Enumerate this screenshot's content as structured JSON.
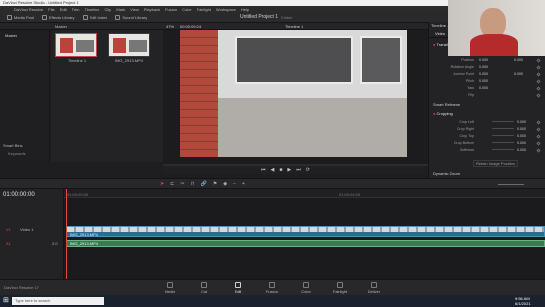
{
  "window": {
    "title": "DaVinci Resolve Studio - Untitled Project 1"
  },
  "menu": [
    "DaVinci Resolve",
    "File",
    "Edit",
    "Trim",
    "Timeline",
    "Clip",
    "Mark",
    "View",
    "Playback",
    "Fusion",
    "Color",
    "Fairlight",
    "Workspace",
    "Help"
  ],
  "toolbar": {
    "media_pool": "Media Pool",
    "effects_library": "Effects Library",
    "edit_index": "Edit Index",
    "sound_library": "Sound Library",
    "project_title": "Untitled Project 1",
    "project_status": "Edited",
    "mixer": "Mixer",
    "metadata": "Metadata",
    "inspector": "Inspector"
  },
  "subbar": {
    "bin_label": "Master",
    "zoom": "47%",
    "source_timecode": "00:00:09:24",
    "timeline_name": "Timeline 1",
    "timeline_name_right": "Timeline - I..."
  },
  "left_panel": {
    "master": "Master",
    "smart_bins": "Smart Bins",
    "keywords": "Keywords"
  },
  "media_pool": {
    "clips": [
      {
        "name": "Timeline 1"
      },
      {
        "name": "IMG_2913.MP4"
      }
    ]
  },
  "inspector": {
    "tabs": [
      "Video",
      "Audio"
    ],
    "section_transform": "Transform",
    "rows": [
      {
        "label": "Zoom",
        "x": "1.000",
        "y": "1.000"
      },
      {
        "label": "Position",
        "x": "0.000",
        "y": "0.000"
      },
      {
        "label": "Rotation Angle",
        "x": "0.000"
      },
      {
        "label": "Anchor Point",
        "x": "0.000",
        "y": "0.000"
      },
      {
        "label": "Pitch",
        "x": "0.000"
      },
      {
        "label": "Yaw",
        "x": "0.000"
      },
      {
        "label": "Flip",
        "x": ""
      }
    ],
    "section_smart_reframe": "Smart Reframe",
    "section_cropping": "Cropping",
    "crop_rows": [
      {
        "label": "Crop Left",
        "x": "0.000"
      },
      {
        "label": "Crop Right",
        "x": "0.000"
      },
      {
        "label": "Crop Top",
        "x": "0.000"
      },
      {
        "label": "Crop Bottom",
        "x": "0.000"
      },
      {
        "label": "Softness",
        "x": "0.000"
      }
    ],
    "retain_image": "Retain Image Position",
    "section_dynamic_zoom": "Dynamic Zoom"
  },
  "timeline": {
    "timecode": "01:00:00:00",
    "ruler_start": "01:00:00:00",
    "ruler_mid": "01:00:04:00",
    "video_track": "V1",
    "video_track_name": "Video 1",
    "audio_track": "A1",
    "audio_level": "2.0",
    "video_clip": "IMG_2913.MP4",
    "audio_clip": "IMG_2913.MP4"
  },
  "pages": [
    "Media",
    "Cut",
    "Edit",
    "Fusion",
    "Color",
    "Fairlight",
    "Deliver"
  ],
  "app_footer": "DaVinci Resolve 17",
  "taskbar": {
    "search_placeholder": "Type here to search",
    "time": "9:56 AM",
    "date": "6/1/2021"
  },
  "colors": {
    "accent": "#e04545",
    "clip_video": "#2d6a8e",
    "clip_audio": "#3a7a52"
  }
}
